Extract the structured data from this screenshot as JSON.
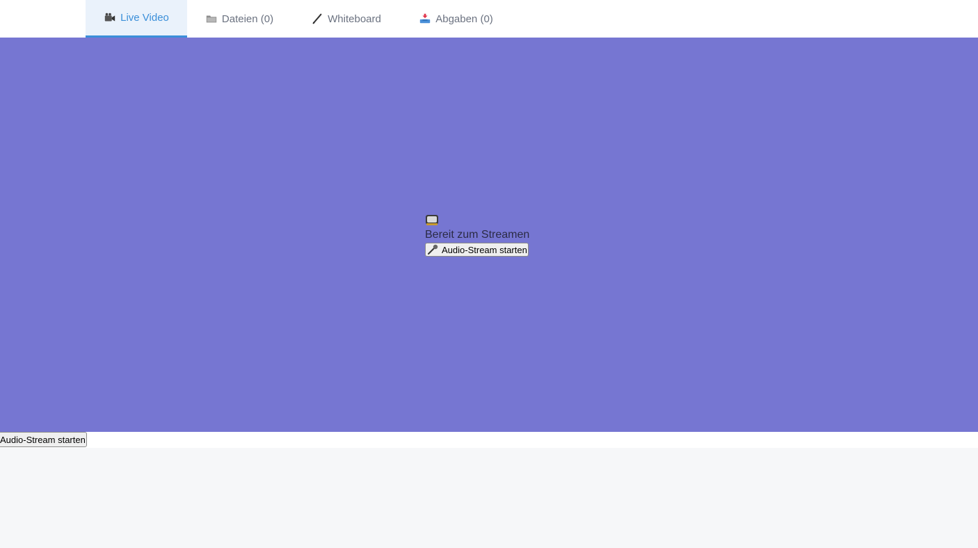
{
  "tabs": [
    {
      "label": "Live Video",
      "icon": "video-camera-icon",
      "active": true
    },
    {
      "label": "Dateien (0)",
      "icon": "folder-icon",
      "active": false
    },
    {
      "label": "Whiteboard",
      "icon": "pen-icon",
      "active": false
    },
    {
      "label": "Abgaben (0)",
      "icon": "inbox-tray-icon",
      "active": false
    }
  ],
  "stage": {
    "icon": "television-icon",
    "status_text": "Bereit zum Streamen",
    "start_button_label": "Audio-Stream starten",
    "background_color": "#7676d2"
  },
  "bottom": {
    "start_button_label": "Audio-Stream starten"
  },
  "colors": {
    "accent": "#3b8fd9",
    "tab_active_bg": "#eaf2fb"
  }
}
